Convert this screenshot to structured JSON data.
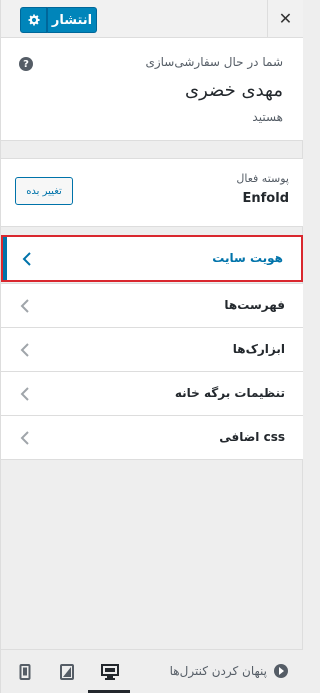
{
  "header": {
    "close_symbol": "✕",
    "publish_label": "انتشار",
    "gear_icon": "gear-icon"
  },
  "info": {
    "customizing_label": "شما در حال سفارشی‌سازی",
    "site_name": "مهدی خضری",
    "after_label": "هستید",
    "help_symbol": "?"
  },
  "theme": {
    "active_label": "پوسته فعال",
    "name": "Enfold",
    "change_label": "تغییر بده"
  },
  "menu": {
    "items": [
      {
        "label": "هویت سایت",
        "active": true
      },
      {
        "label": "فهرست‌ها",
        "active": false
      },
      {
        "label": "ابزارک‌ها",
        "active": false
      },
      {
        "label": "تنظیمات برگه خانه",
        "active": false
      },
      {
        "label": "css اضافی",
        "active": false
      }
    ]
  },
  "footer": {
    "collapse_label": "پنهان کردن کنترل‌ها",
    "devices": [
      "mobile-icon",
      "tablet-icon",
      "desktop-icon"
    ],
    "active_device": "desktop-icon"
  },
  "colors": {
    "accent": "#0085ba",
    "highlight_border": "#d9272e",
    "link": "#0073aa"
  }
}
